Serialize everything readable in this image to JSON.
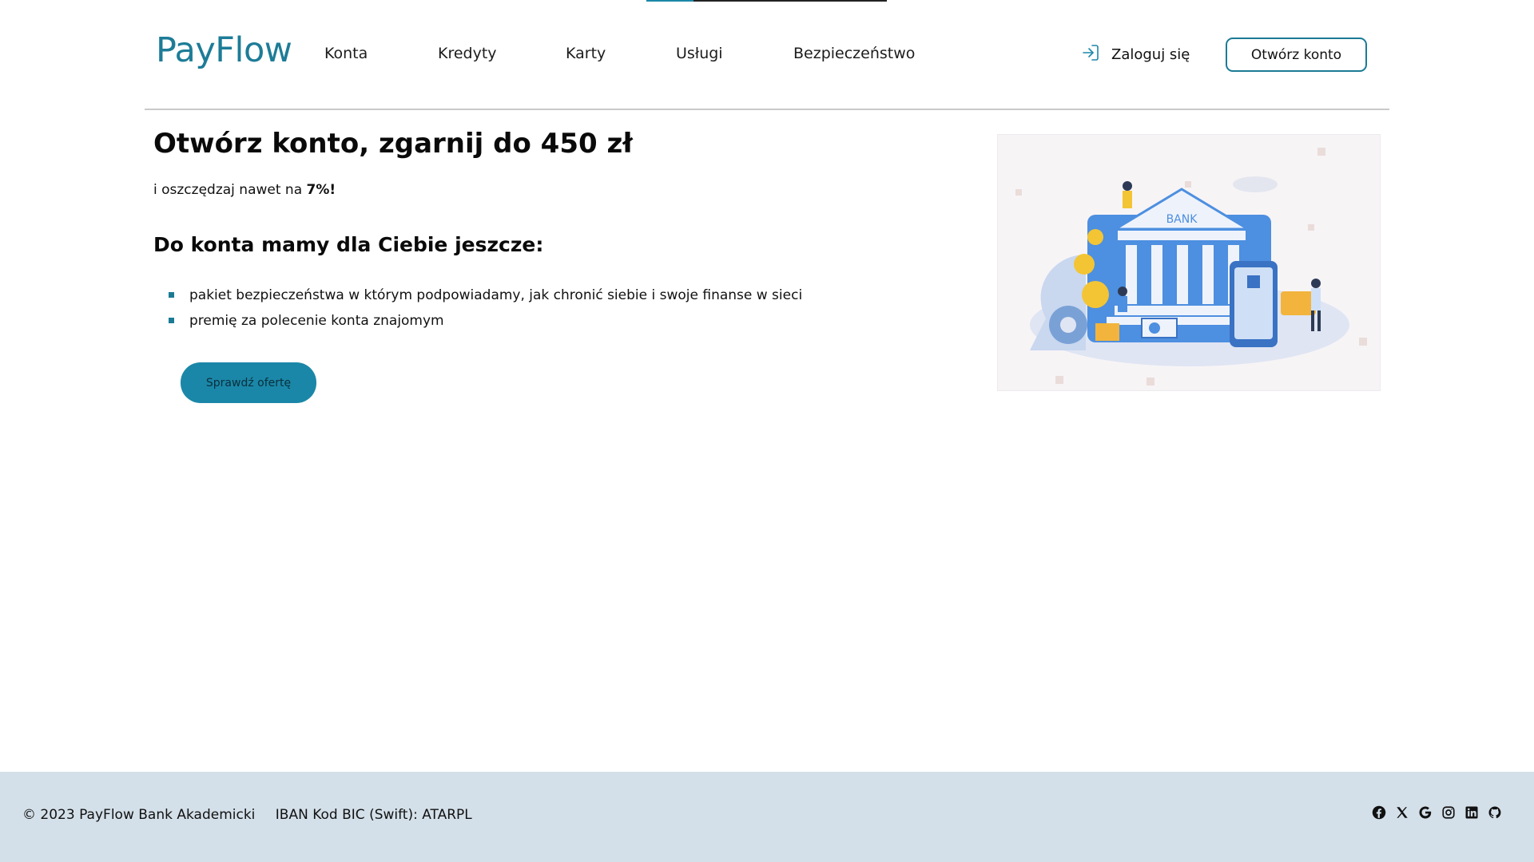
{
  "header": {
    "logo": "PayFlow",
    "nav": [
      "Konta",
      "Kredyty",
      "Karty",
      "Usługi",
      "Bezpieczeństwo"
    ],
    "login_label": "Zaloguj się",
    "open_account_label": "Otwórz konto"
  },
  "hero": {
    "title": "Otwórz konto, zgarnij do 450 zł",
    "subtitle_prefix": "i oszczędzaj nawet na ",
    "subtitle_highlight": "7%!",
    "section_title": "Do konta mamy dla Ciebie jeszcze:",
    "features": [
      "pakiet bezpieczeństwa w którym podpowiadamy, jak chronić siebie i swoje finanse w sieci",
      "premię za polecenie konta znajomym"
    ],
    "cta_label": "Sprawdź ofertę",
    "illustration_label": "BANK"
  },
  "footer": {
    "copyright": "© 2023 PayFlow Bank Akademicki",
    "iban": "IBAN Kod BIC (Swift): ATARPL",
    "socials": [
      "facebook-icon",
      "x-icon",
      "google-icon",
      "instagram-icon",
      "linkedin-icon",
      "github-icon"
    ]
  },
  "colors": {
    "brand": "#1d7c97",
    "cta": "#1b87a8",
    "footer_bg": "#d4e0e9",
    "bullet": "#1b7b95"
  }
}
